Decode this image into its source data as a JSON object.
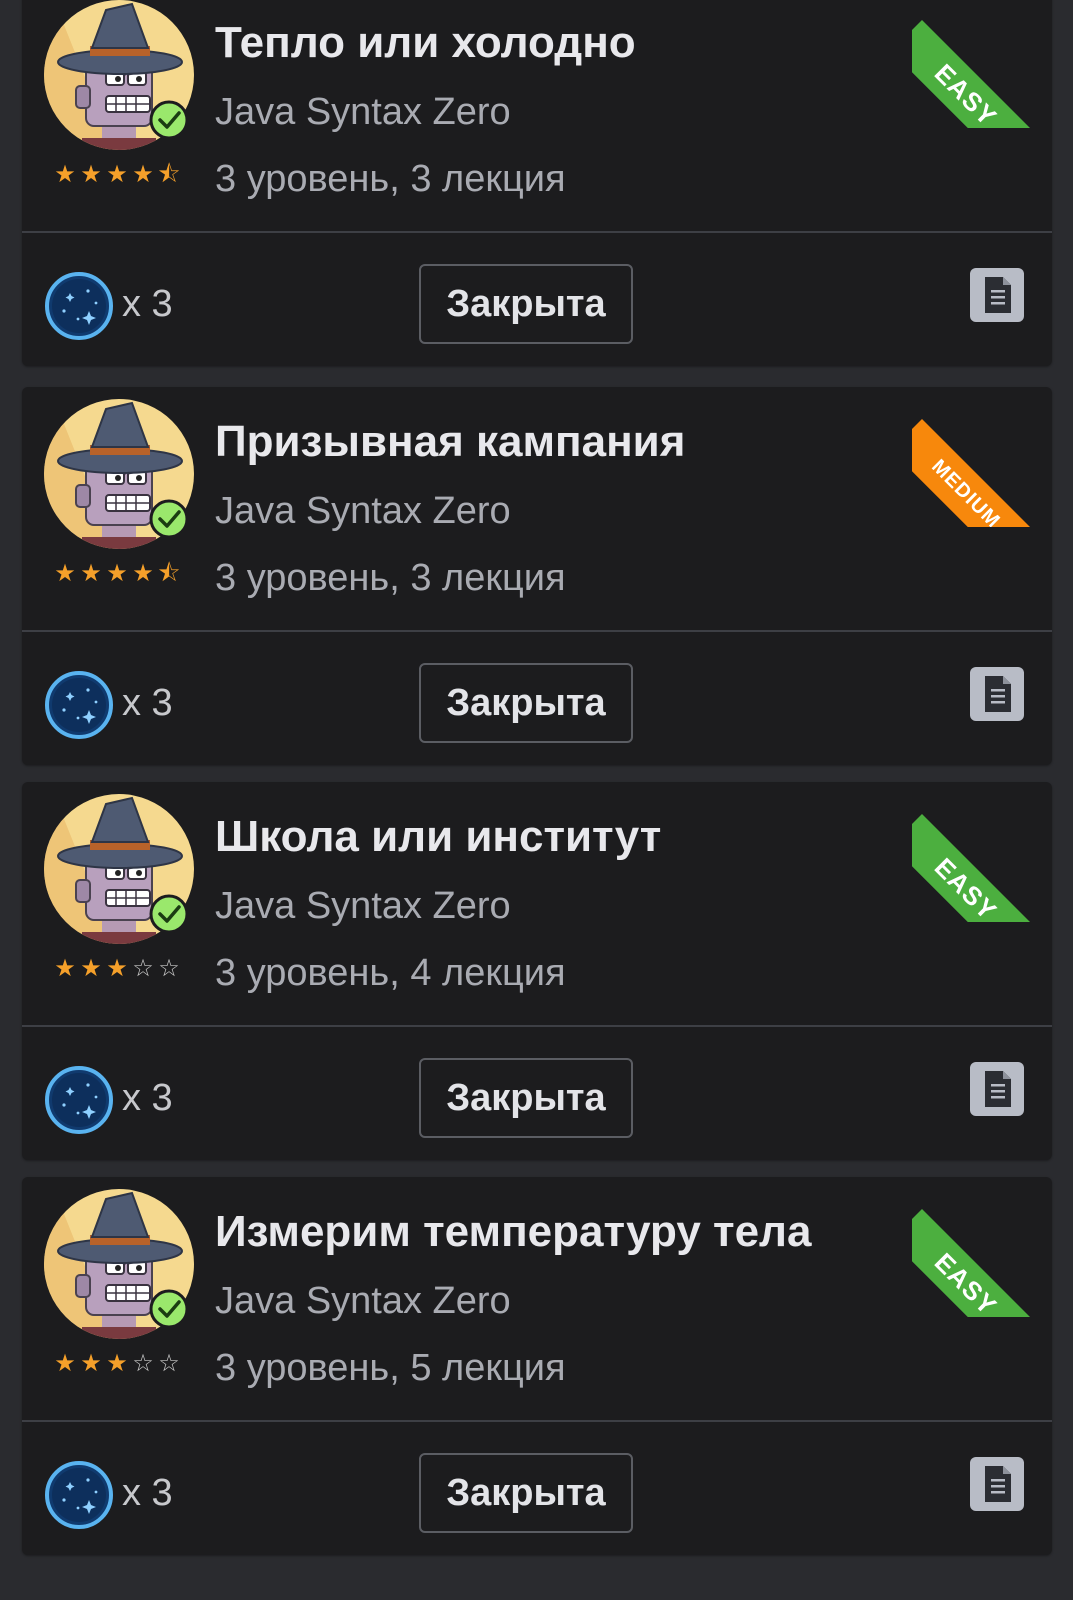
{
  "colors": {
    "page_background": "#2a2b2f",
    "card_background": "#1c1c1e",
    "easy": "#4caf3f",
    "medium": "#f7880c",
    "star": "#f5a02a",
    "check": "#9ae86c"
  },
  "tasks": [
    {
      "title": "Тепло или холодно",
      "course": "Java Syntax Zero",
      "level": "3 уровень, 3 лекция",
      "rating": 4.5,
      "difficulty": "EASY",
      "reward": "x 3",
      "status": "Закрыта",
      "completed": true
    },
    {
      "title": "Призывная кампания",
      "course": "Java Syntax Zero",
      "level": "3 уровень, 3 лекция",
      "rating": 4.5,
      "difficulty": "MEDIUM",
      "reward": "x 3",
      "status": "Закрыта",
      "completed": true
    },
    {
      "title": "Школа или институт",
      "course": "Java Syntax Zero",
      "level": "3 уровень, 4 лекция",
      "rating": 3,
      "difficulty": "EASY",
      "reward": "x 3",
      "status": "Закрыта",
      "completed": true
    },
    {
      "title": "Измерим температуру тела",
      "course": "Java Syntax Zero",
      "level": "3 уровень, 5 лекция",
      "rating": 3,
      "difficulty": "EASY",
      "reward": "x 3",
      "status": "Закрыта",
      "completed": true
    }
  ],
  "icons": {
    "avatar": "robot-wizard-avatar-icon",
    "check": "check-circle-icon",
    "reward": "dark-matter-planet-icon",
    "document": "document-icon"
  }
}
